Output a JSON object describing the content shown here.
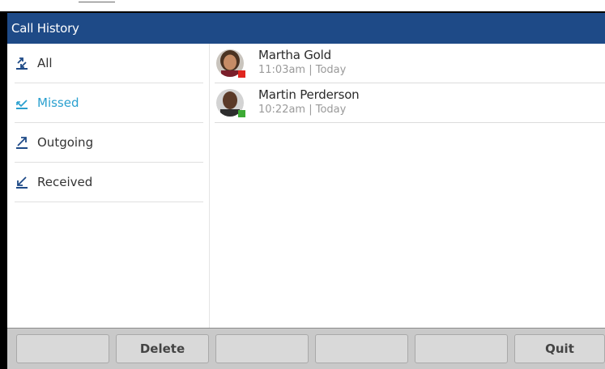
{
  "header": {
    "title": "Call History"
  },
  "sidebar": {
    "items": [
      {
        "label": "All",
        "icon": "all-calls-icon"
      },
      {
        "label": "Missed",
        "icon": "missed-call-icon",
        "active": true
      },
      {
        "label": "Outgoing",
        "icon": "outgoing-call-icon"
      },
      {
        "label": "Received",
        "icon": "received-call-icon"
      }
    ]
  },
  "calls": [
    {
      "name": "Martha Gold",
      "time": "11:03am | Today",
      "presence": "busy",
      "presence_color": "#e0261f"
    },
    {
      "name": "Martin Perderson",
      "time": "10:22am | Today",
      "presence": "available",
      "presence_color": "#3daa35"
    }
  ],
  "softkeys": [
    "",
    "Delete",
    "",
    "",
    "",
    "Quit"
  ],
  "colors": {
    "header_bg": "#1e4a87",
    "active_item": "#2aa0cf",
    "icon_dark": "#1e4a87"
  }
}
